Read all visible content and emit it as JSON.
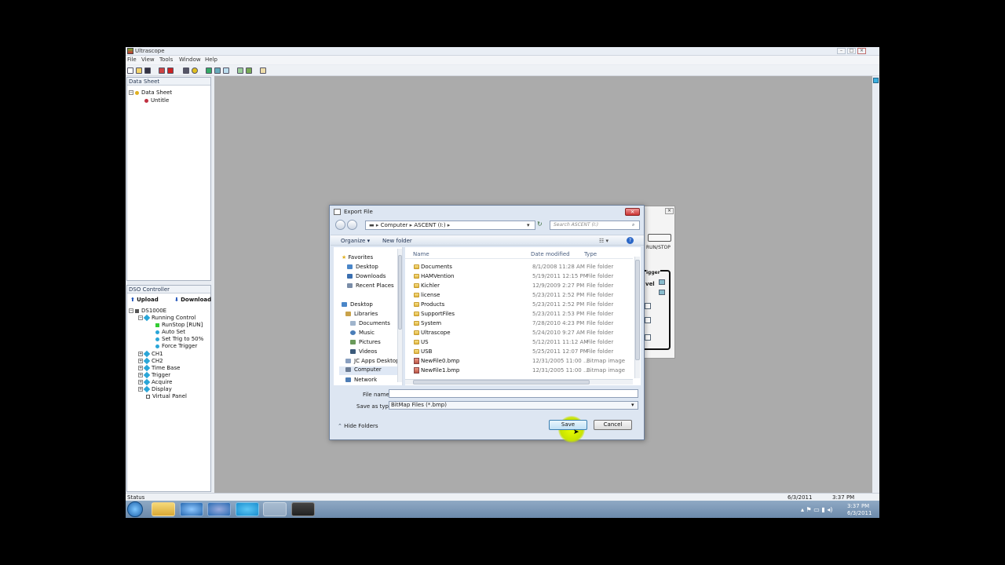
{
  "app": {
    "title": "Ultrascope",
    "menus": [
      "File",
      "View",
      "Tools",
      "Window",
      "Help"
    ]
  },
  "datasheet_pane": {
    "header": "Data Sheet",
    "root": "Data Sheet",
    "child": "Untitle"
  },
  "dso_pane": {
    "header": "DSO Controller",
    "upload": "Upload",
    "download": "Download",
    "device": "DS1000E",
    "running_control": "Running Control",
    "children": [
      "RunStop [RUN]",
      "Auto Set",
      "Set Trig to 50%",
      "Force Trigger"
    ],
    "groups": [
      "CH1",
      "CH2",
      "Time Base",
      "Trigger",
      "Acquire",
      "Display"
    ],
    "virtual_panel": "Virtual Panel"
  },
  "bg_panel": {
    "run_stop": "RUN/STOP",
    "trigger": "igger",
    "level": "vel"
  },
  "dialog": {
    "title": "Export File",
    "address_parts": [
      "Computer",
      "ASCENT (I:)"
    ],
    "search_placeholder": "Search ASCENT (I:)",
    "organize": "Organize ▾",
    "new_folder": "New folder",
    "nav": {
      "favorites": "Favorites",
      "favorite_items": [
        "Desktop",
        "Downloads",
        "Recent Places"
      ],
      "desktop": "Desktop",
      "libraries": "Libraries",
      "library_items": [
        "Documents",
        "Music",
        "Pictures",
        "Videos"
      ],
      "other_items": [
        "JC Apps Desktop",
        "Computer",
        "Network"
      ]
    },
    "columns": {
      "name": "Name",
      "date": "Date modified",
      "type": "Type"
    },
    "files": [
      {
        "name": "Documents",
        "date": "8/1/2008 11:28 AM",
        "type": "File folder",
        "kind": "folder"
      },
      {
        "name": "HAMVention",
        "date": "5/19/2011 12:15 PM",
        "type": "File folder",
        "kind": "folder"
      },
      {
        "name": "Kichler",
        "date": "12/9/2009 2:27 PM",
        "type": "File folder",
        "kind": "folder"
      },
      {
        "name": "license",
        "date": "5/23/2011 2:52 PM",
        "type": "File folder",
        "kind": "folder"
      },
      {
        "name": "Products",
        "date": "5/23/2011 2:52 PM",
        "type": "File folder",
        "kind": "folder"
      },
      {
        "name": "SupportFiles",
        "date": "5/23/2011 2:53 PM",
        "type": "File folder",
        "kind": "folder"
      },
      {
        "name": "System",
        "date": "7/28/2010 4:23 PM",
        "type": "File folder",
        "kind": "folder"
      },
      {
        "name": "Ultrascope",
        "date": "5/24/2010 9:27 AM",
        "type": "File folder",
        "kind": "folder"
      },
      {
        "name": "US",
        "date": "5/12/2011 11:12 AM",
        "type": "File folder",
        "kind": "folder"
      },
      {
        "name": "USB",
        "date": "5/25/2011 12:07 PM",
        "type": "File folder",
        "kind": "folder"
      },
      {
        "name": "NewFile0.bmp",
        "date": "12/31/2005 11:00 ...",
        "type": "Bitmap image",
        "kind": "bmp"
      },
      {
        "name": "NewFile1.bmp",
        "date": "12/31/2005 11:00 ...",
        "type": "Bitmap image",
        "kind": "bmp"
      }
    ],
    "file_name_label": "File name:",
    "file_name_value": "",
    "save_type_label": "Save as type:",
    "save_type_value": "BitMap Files (*.bmp)",
    "hide_folders": "Hide Folders",
    "save": "Save",
    "cancel": "Cancel"
  },
  "status": {
    "text": "Status",
    "date": "6/3/2011",
    "time": "3:37 PM"
  },
  "tray": {
    "time": "3:37 PM",
    "date": "6/3/2011"
  }
}
